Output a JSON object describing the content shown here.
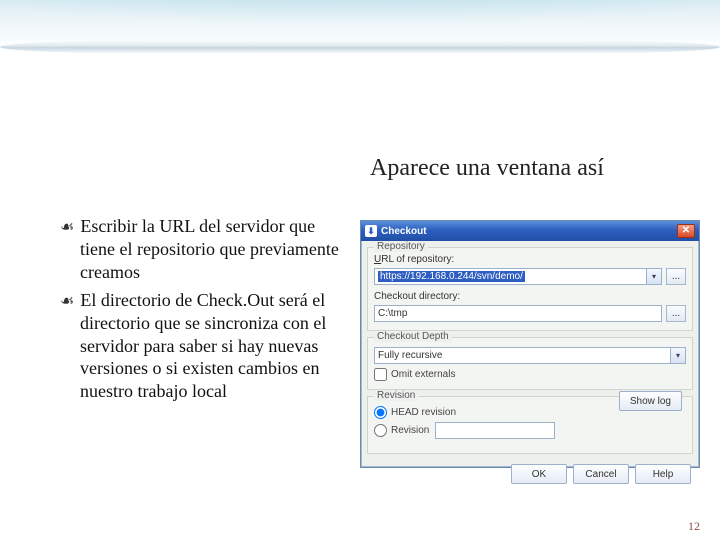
{
  "slide": {
    "title": "Aparece una ventana así",
    "bullets": [
      "Escribir la URL del servidor que tiene el repositorio que previamente creamos",
      "El directorio de Check.Out será el directorio que se sincroniza con el servidor para saber si hay nuevas versiones o si existen cambios en nuestro trabajo local"
    ],
    "page_number": "12"
  },
  "dialog": {
    "icon_glyph": "⬇",
    "title": "Checkout",
    "close_glyph": "✕",
    "group_repository": {
      "label": "Repository",
      "url_label": "URL of repository:",
      "url_value": "https://192.168.0.244/svn/demo/",
      "url_browse": "...",
      "dir_label": "Checkout directory:",
      "dir_value": "C:\\tmp",
      "dir_browse": "..."
    },
    "group_depth": {
      "label": "Checkout Depth",
      "select_value": "Fully recursive",
      "omit_externals_label": "Omit externals"
    },
    "group_revision": {
      "label": "Revision",
      "head_label": "HEAD revision",
      "rev_label": "Revision",
      "rev_value": "",
      "show_log": "Show log"
    },
    "buttons": {
      "ok": "OK",
      "cancel": "Cancel",
      "help": "Help"
    }
  }
}
